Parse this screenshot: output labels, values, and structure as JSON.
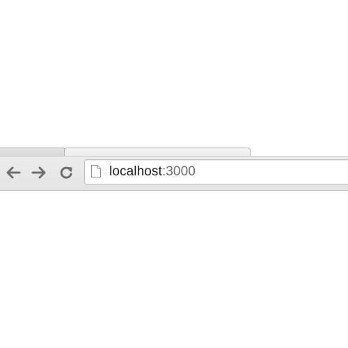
{
  "tabs": [
    {
      "label": "",
      "active": false
    },
    {
      "label": "",
      "active": true
    }
  ],
  "toolbar": {
    "back_icon": "back-arrow-icon",
    "forward_icon": "forward-arrow-icon",
    "reload_icon": "reload-icon"
  },
  "omnibox": {
    "page_icon": "page-document-icon",
    "host": "localhost",
    "port": ":3000"
  },
  "colors": {
    "toolbar_bg": "#e8e8e8",
    "icon_gray": "#6e6e6e",
    "host_text": "#1a1a1a",
    "port_text": "#6b6b6b"
  }
}
